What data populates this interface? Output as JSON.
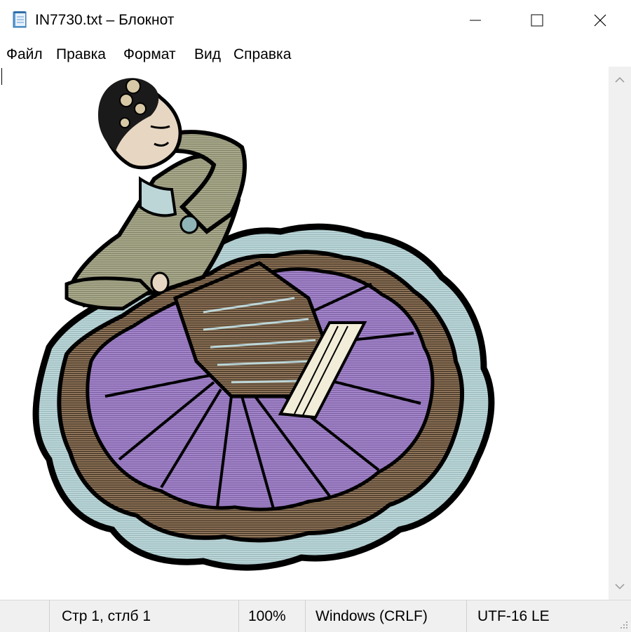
{
  "window": {
    "title": "IN7730.txt – Блокнот",
    "icon": "notepad-icon",
    "controls": [
      "minimize-icon",
      "maximize-icon",
      "close-icon"
    ]
  },
  "menu": {
    "items": [
      "Файл",
      "Правка",
      "Формат",
      "Вид",
      "Справка"
    ]
  },
  "editor": {
    "content_description": "ASCII-art style image of a dancer in a wide purple and light-blue ruffled skirt"
  },
  "status": {
    "position": "Стр 1, стлб 1",
    "zoom": "100%",
    "line_endings": "Windows (CRLF)",
    "encoding": "UTF-16 LE"
  },
  "colors": {
    "skirt_purple": "#a384c9",
    "ruffle_blue": "#bcd6d8",
    "jacket_olive": "#a8a88a",
    "outline": "#000000"
  }
}
